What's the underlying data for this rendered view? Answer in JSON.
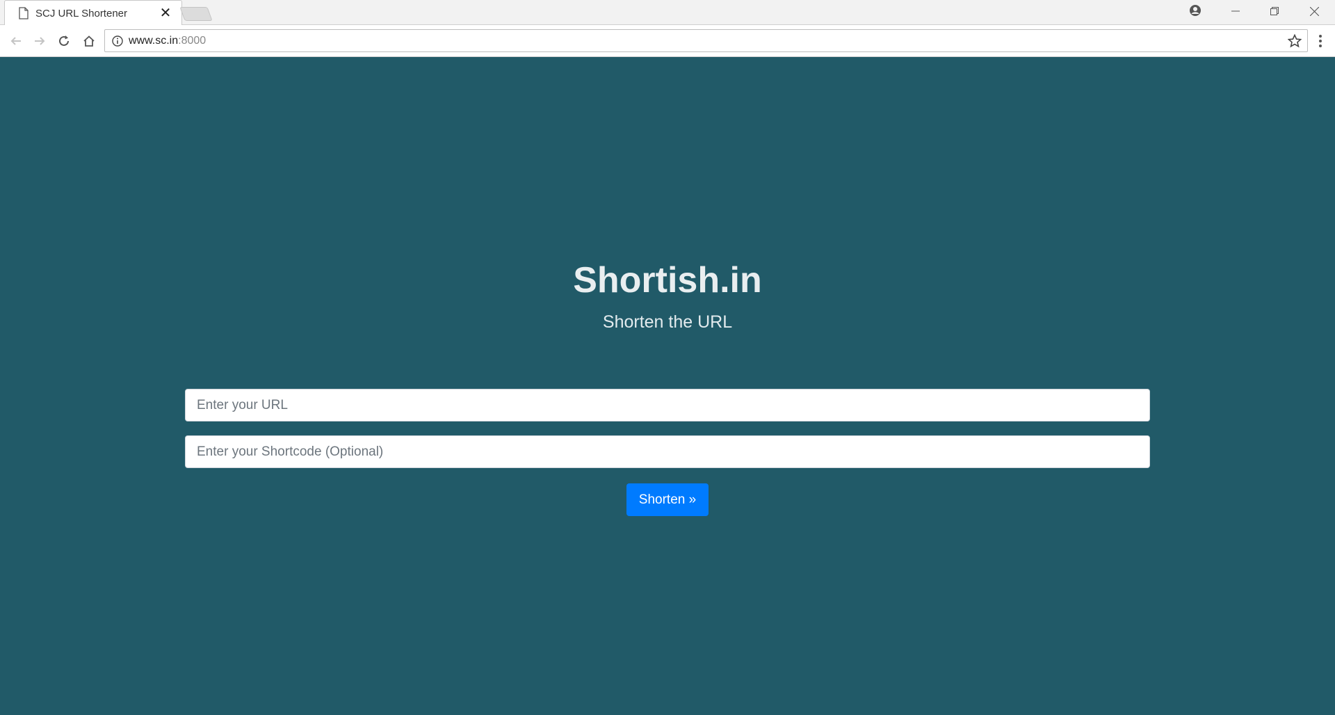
{
  "browser": {
    "tab_title": "SCJ URL Shortener",
    "tab_close": "✕",
    "url_host": "www.sc.in",
    "url_port": ":8000"
  },
  "page": {
    "title": "Shortish.in",
    "subtitle": "Shorten the URL",
    "url_input": {
      "placeholder": "Enter your URL",
      "value": ""
    },
    "shortcode_input": {
      "placeholder": "Enter your Shortcode (Optional)",
      "value": ""
    },
    "shorten_button": "Shorten »"
  },
  "colors": {
    "page_background": "#215a68",
    "button_primary": "#007bff"
  },
  "icons": [
    "page-icon",
    "close-icon",
    "profile-icon",
    "minimize-icon",
    "maximize-icon",
    "window-close-icon",
    "back-icon",
    "forward-icon",
    "reload-icon",
    "home-icon",
    "info-icon",
    "star-icon",
    "menu-icon"
  ]
}
